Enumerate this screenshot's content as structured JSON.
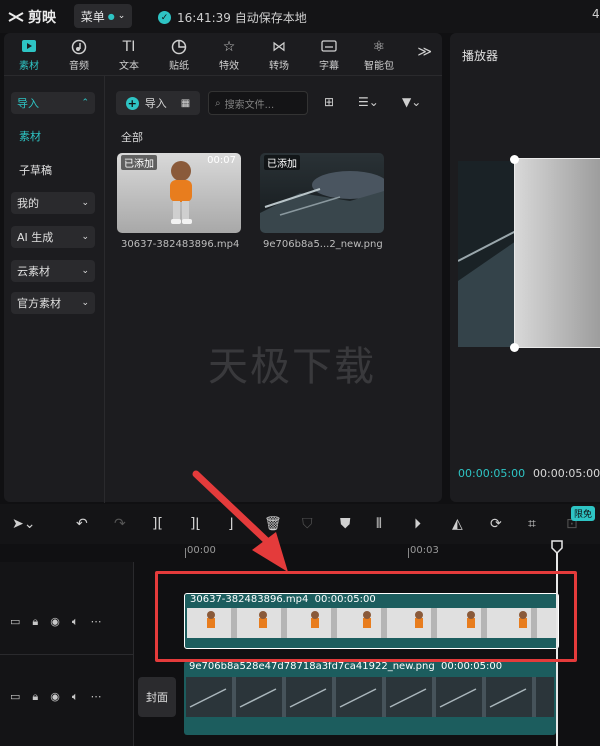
{
  "titlebar": {
    "app_name": "剪映",
    "menu_label": "菜单",
    "save_status": "16:41:39 自动保存本地",
    "right_edge_text": "4"
  },
  "media_tabs": [
    {
      "label": "素材",
      "icon": "media-icon"
    },
    {
      "label": "音频",
      "icon": "audio-icon"
    },
    {
      "label": "文本",
      "icon": "text-icon"
    },
    {
      "label": "贴纸",
      "icon": "sticker-icon"
    },
    {
      "label": "特效",
      "icon": "effects-icon"
    },
    {
      "label": "转场",
      "icon": "transition-icon"
    },
    {
      "label": "字幕",
      "icon": "subtitle-icon"
    },
    {
      "label": "智能包",
      "icon": "smart-pack-icon"
    }
  ],
  "sidebar": {
    "import": "导入",
    "material": "素材",
    "draft": "子草稿",
    "mine": "我的",
    "ai_generate": "AI 生成",
    "cloud": "云素材",
    "official": "官方素材"
  },
  "media": {
    "import_label": "导入",
    "search_placeholder": "搜索文件...",
    "all_label": "全部",
    "items": [
      {
        "tag": "已添加",
        "duration": "00:07",
        "name": "30637-382483896.mp4"
      },
      {
        "tag": "已添加",
        "duration": "",
        "name": "9e706b8a5...2_new.png"
      }
    ],
    "watermark": "天极下载"
  },
  "player": {
    "title": "播放器",
    "current_time": "00:00:05:00",
    "total_time": "00:00:05:00"
  },
  "toolbar": {
    "free_badge": "限免"
  },
  "timeline": {
    "ticks": [
      "00:00",
      "00:03"
    ],
    "cover_label": "封面",
    "clips": [
      {
        "name": "30637-382483896.mp4",
        "duration": "00:00:05:00"
      },
      {
        "name": "9e706b8a528e47d78718a3fd7ca41922_new.png",
        "duration": "00:00:05:00"
      }
    ]
  },
  "colors": {
    "accent": "#2ec4c4",
    "highlight": "#e43b3b",
    "clip_bg": "#1c5d5e"
  }
}
